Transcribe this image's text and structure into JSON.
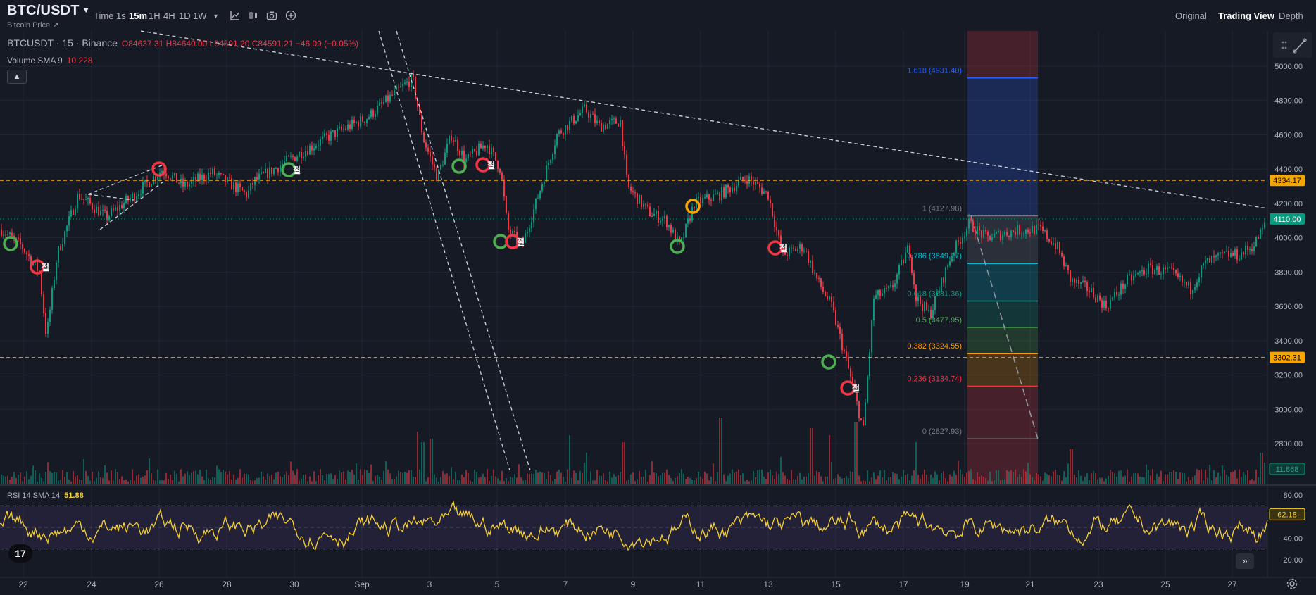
{
  "header": {
    "symbol": "BTC/USDT",
    "subtitle": "Bitcoin Price ↗",
    "timeframes": [
      {
        "label": "Time",
        "active": false
      },
      {
        "label": "1s",
        "active": false
      },
      {
        "label": "15m",
        "active": true
      },
      {
        "label": "1H",
        "active": false
      },
      {
        "label": "4H",
        "active": false
      },
      {
        "label": "1D",
        "active": false
      },
      {
        "label": "1W",
        "active": false
      }
    ],
    "view_tabs": [
      {
        "label": "Original",
        "active": false
      },
      {
        "label": "Trading View",
        "active": true
      },
      {
        "label": "Depth",
        "active": false
      }
    ]
  },
  "legend": {
    "instrument": "BTCUSDT · 15 · Binance",
    "ohlc": "O84637.31 H84640.00 L84591.20 C84591.21 −46.09 (−0.05%)",
    "volume_label": "Volume SMA 9",
    "volume_value": "10.228",
    "rsi_label": "RSI 14 SMA 14",
    "rsi_value": "51.88"
  },
  "price_axis": {
    "ticks": [
      "5000.00",
      "4800.00",
      "4600.00",
      "4400.00",
      "4200.00",
      "4000.00",
      "3800.00",
      "3600.00",
      "3400.00",
      "3200.00",
      "3000.00",
      "2800.00"
    ],
    "badges": [
      {
        "price": 4334.17,
        "text": "4334.17",
        "color": "#f7a600",
        "text_color": "#000000"
      },
      {
        "price": 4110.0,
        "text": "4110.00",
        "color": "#089981",
        "text_color": "#ffffff"
      },
      {
        "price": 3302.31,
        "text": "3302.31",
        "color": "#f7a600",
        "text_color": "#000000"
      }
    ],
    "volume_badge": "11.868",
    "rsi_ticks": [
      "80.00",
      "60.00",
      "40.00",
      "20.00"
    ],
    "rsi_badge": "62.18"
  },
  "time_axis": {
    "labels": [
      "22",
      "24",
      "26",
      "28",
      "30",
      "Sep",
      "3",
      "5",
      "7",
      "9",
      "11",
      "13",
      "15",
      "17",
      "19",
      "21",
      "23",
      "25",
      "27"
    ]
  },
  "fibonacci": {
    "levels": [
      {
        "ratio": 1.618,
        "label": "1.618 (4931.40)",
        "price": 4931.4,
        "color": "#2962ff"
      },
      {
        "ratio": 1,
        "label": "1 (4127.98)",
        "price": 4127.98,
        "color": "#787b86"
      },
      {
        "ratio": 0.786,
        "label": "0.786 (3849.77)",
        "price": 3849.77,
        "color": "#00bcd4"
      },
      {
        "ratio": 0.618,
        "label": "0.618 (3631.36)",
        "price": 3631.36,
        "color": "#089981"
      },
      {
        "ratio": 0.5,
        "label": "0.5 (3477.95)",
        "price": 3477.95,
        "color": "#4caf50"
      },
      {
        "ratio": 0.382,
        "label": "0.382 (3324.55)",
        "price": 3324.55,
        "color": "#ff9800"
      },
      {
        "ratio": 0.236,
        "label": "0.236 (3134.74)",
        "price": 3134.74,
        "color": "#f23645"
      },
      {
        "ratio": 0,
        "label": "0 (2827.93)",
        "price": 2827.93,
        "color": "#787b86"
      }
    ]
  },
  "markers": [
    {
      "color": "#4caf50",
      "text": ""
    },
    {
      "color": "#f23645",
      "text": "절"
    },
    {
      "color": "#f23645",
      "text": ""
    },
    {
      "color": "#4caf50",
      "text": "절"
    },
    {
      "color": "#4caf50",
      "text": ""
    },
    {
      "color": "#f23645",
      "text": "절"
    },
    {
      "color": "#4caf50",
      "text": ""
    },
    {
      "color": "#f23645",
      "text": "절"
    },
    {
      "color": "#4caf50",
      "text": ""
    },
    {
      "color": "#f7a600",
      "text": ""
    },
    {
      "color": "#f23645",
      "text": "절"
    },
    {
      "color": "#4caf50",
      "text": ""
    },
    {
      "color": "#f23645",
      "text": "절"
    }
  ],
  "colors": {
    "up": "#089981",
    "down": "#f23645",
    "rsi": "#f7d131",
    "grid": "#232733",
    "background": "#161a25"
  },
  "icons": [
    "indicators-icon",
    "candles-icon",
    "camera-icon",
    "add-icon",
    "settings-icon",
    "goto-realtime-icon",
    "tradingview-logo-icon",
    "chevron-up-icon",
    "chevron-down-icon"
  ]
}
